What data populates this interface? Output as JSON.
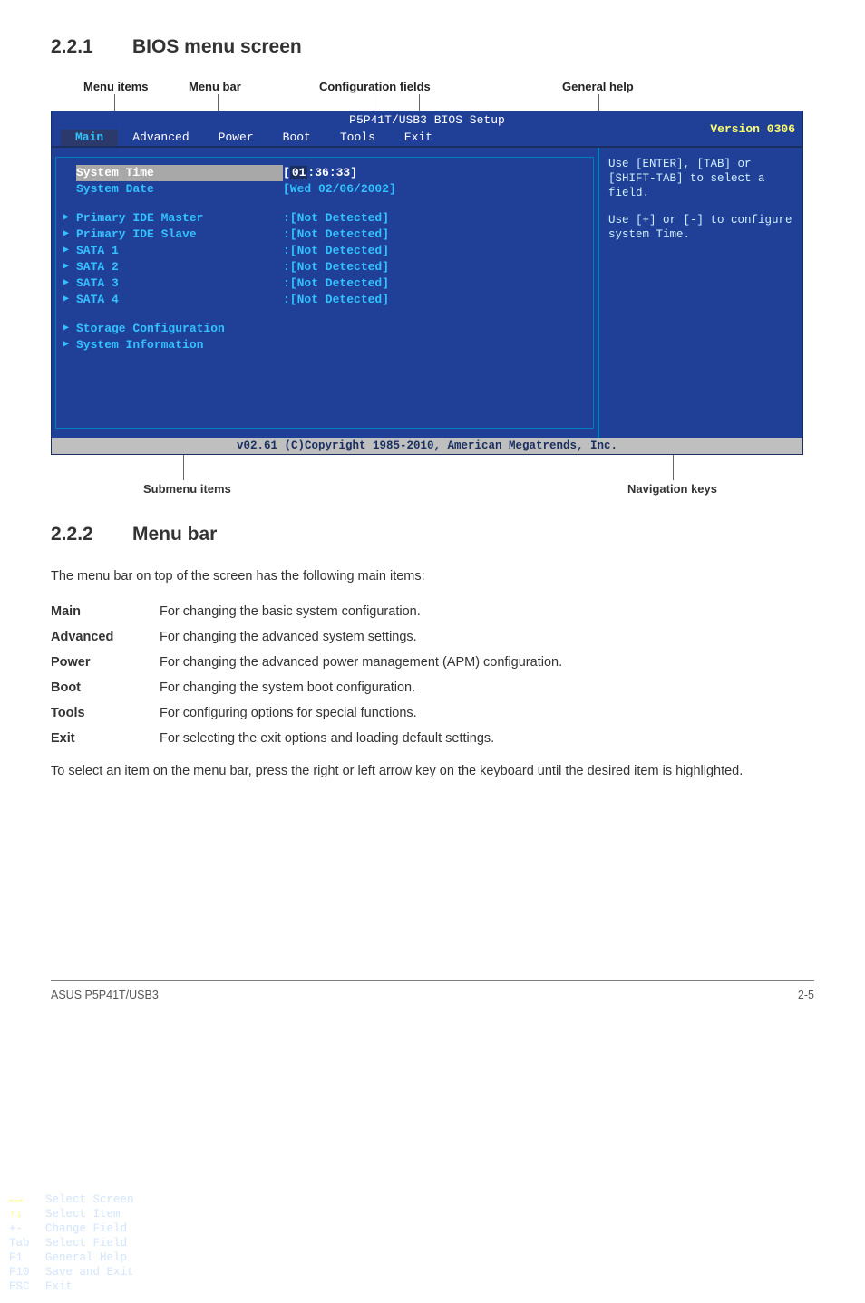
{
  "section1": {
    "num": "2.2.1",
    "title": "BIOS menu screen"
  },
  "annot_top": {
    "menu_items": "Menu items",
    "menu_bar": "Menu bar",
    "config_fields": "Configuration fields",
    "general_help": "General help"
  },
  "bios": {
    "title": "P5P41T/USB3 BIOS Setup",
    "version": "Version 0306",
    "tabs": [
      "Main",
      "Advanced",
      "Power",
      "Boot",
      "Tools",
      "Exit"
    ],
    "rows": [
      {
        "kind": "selected",
        "label": "System Time",
        "val_prefix": "[",
        "val_edit": "01",
        "val_rest": ":36:33]"
      },
      {
        "kind": "plain",
        "label": "System Date",
        "val": "[Wed 02/06/2002]"
      },
      {
        "kind": "spacer"
      },
      {
        "kind": "sub",
        "label": "Primary IDE Master",
        "val": ":[Not Detected]"
      },
      {
        "kind": "sub",
        "label": "Primary IDE Slave",
        "val": ":[Not Detected]"
      },
      {
        "kind": "sub",
        "label": "SATA 1",
        "val": ":[Not Detected]"
      },
      {
        "kind": "sub",
        "label": "SATA 2",
        "val": ":[Not Detected]"
      },
      {
        "kind": "sub",
        "label": "SATA 3",
        "val": ":[Not Detected]"
      },
      {
        "kind": "sub",
        "label": "SATA 4",
        "val": ":[Not Detected]"
      },
      {
        "kind": "spacer"
      },
      {
        "kind": "sub",
        "label": "Storage Configuration",
        "val": ""
      },
      {
        "kind": "sub",
        "label": "System Information",
        "val": ""
      }
    ],
    "help": {
      "p1": "Use [ENTER], [TAB] or [SHIFT-TAB] to select a field.",
      "p2": "Use [+] or [-] to configure system Time."
    },
    "nav": [
      {
        "key": "←→",
        "desc": "Select Screen",
        "yellow": true
      },
      {
        "key": "↑↓",
        "desc": "Select Item",
        "yellow": true
      },
      {
        "key": "+-",
        "desc": "Change Field"
      },
      {
        "key": "Tab",
        "desc": "Select Field"
      },
      {
        "key": "F1",
        "desc": "General Help"
      },
      {
        "key": "F10",
        "desc": "Save and Exit"
      },
      {
        "key": "ESC",
        "desc": "Exit"
      }
    ],
    "footer": "v02.61 (C)Copyright 1985-2010, American Megatrends, Inc."
  },
  "annot_bottom": {
    "submenu": "Submenu items",
    "navkeys": "Navigation keys"
  },
  "section2": {
    "num": "2.2.2",
    "title": "Menu bar"
  },
  "para1": "The menu bar on top of the screen has the following main items:",
  "menutable": [
    {
      "k": "Main",
      "d": "For changing the basic system configuration."
    },
    {
      "k": "Advanced",
      "d": "For changing the advanced system settings."
    },
    {
      "k": "Power",
      "d": "For changing the advanced power management (APM) configuration."
    },
    {
      "k": "Boot",
      "d": "For changing the system boot configuration."
    },
    {
      "k": "Tools",
      "d": "For configuring options for special functions."
    },
    {
      "k": "Exit",
      "d": "For selecting the exit options and loading default settings."
    }
  ],
  "para2": "To select an item on the menu bar, press the right or left arrow key on the keyboard until the desired item is highlighted.",
  "footer": {
    "left": "ASUS P5P41T/USB3",
    "right": "2-5"
  }
}
